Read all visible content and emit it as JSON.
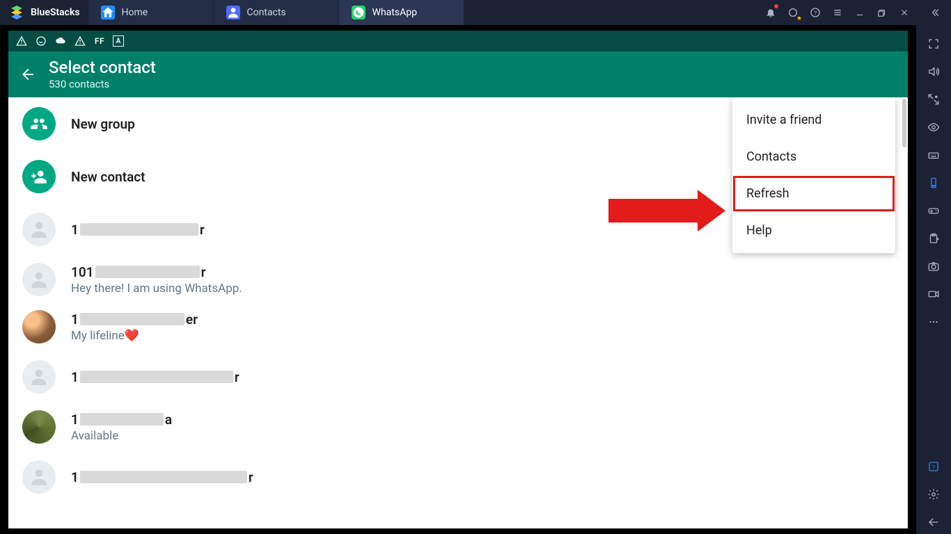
{
  "top": {
    "brand": "BlueStacks",
    "tabs": [
      {
        "id": "home",
        "label": "Home"
      },
      {
        "id": "contacts",
        "label": "Contacts"
      },
      {
        "id": "whatsapp",
        "label": "WhatsApp"
      }
    ]
  },
  "whatsapp": {
    "title": "Select contact",
    "subtitle": "530 contacts",
    "actions": {
      "new_group": "New group",
      "new_contact": "New contact"
    },
    "contacts": [
      {
        "prefix": "1",
        "suffix": "r",
        "status": ""
      },
      {
        "prefix": "101",
        "suffix": "r",
        "status": "Hey there! I am using WhatsApp."
      },
      {
        "prefix": "1",
        "suffix": "er",
        "status": "My lifeline❤️"
      },
      {
        "prefix": "1",
        "suffix": "r",
        "status": ""
      },
      {
        "prefix": "1",
        "suffix": "a",
        "status": "Available"
      },
      {
        "prefix": "1",
        "suffix": "r",
        "status": ""
      }
    ],
    "menu": {
      "invite": "Invite a friend",
      "contacts": "Contacts",
      "refresh": "Refresh",
      "help": "Help"
    }
  },
  "statusbar_icons": [
    "warning",
    "whatsapp",
    "cloud",
    "warning",
    "FF",
    "A"
  ]
}
